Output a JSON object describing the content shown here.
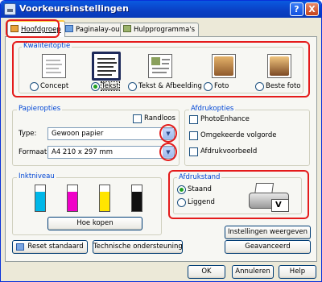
{
  "window": {
    "title": "Voorkeursinstellingen",
    "help_label": "?",
    "close_label": "X"
  },
  "tabs": [
    {
      "label": "Hoofdgroep"
    },
    {
      "label": "Paginalay-out"
    },
    {
      "label": "Hulpprogramma's"
    }
  ],
  "quality": {
    "group_label": "Kwaliteitoptie",
    "options": [
      {
        "label": "Concept",
        "selected": false
      },
      {
        "label": "Tekst",
        "selected": true
      },
      {
        "label": "Tekst & Afbeelding",
        "selected": false
      },
      {
        "label": "Foto",
        "selected": false
      },
      {
        "label": "Beste foto",
        "selected": false
      }
    ]
  },
  "paper": {
    "group_label": "Papieropties",
    "borderless_label": "Randloos",
    "type_label": "Type:",
    "type_value": "Gewoon papier",
    "format_label": "Formaat:",
    "format_value": "A4 210 x 297 mm"
  },
  "print_options": {
    "group_label": "Afdrukopties",
    "items": [
      {
        "label": "PhotoEnhance",
        "checked": false
      },
      {
        "label": "Omgekeerde volgorde",
        "checked": false
      },
      {
        "label": "Afdrukvoorbeeld",
        "checked": false
      }
    ]
  },
  "ink": {
    "group_label": "Inktniveau",
    "levels": [
      {
        "color": "#00b7e8",
        "level": 0.75
      },
      {
        "color": "#f000c8",
        "level": 0.75
      },
      {
        "color": "#ffe500",
        "level": 0.75
      },
      {
        "color": "#111111",
        "level": 0.75
      }
    ],
    "buy_button": "Hoe kopen"
  },
  "orientation": {
    "group_label": "Afdrukstand",
    "portrait_label": "Staand",
    "landscape_label": "Liggend",
    "selected": "portrait"
  },
  "buttons": {
    "show_settings": "Instellingen weergeven",
    "advanced": "Geavanceerd",
    "reset": "Reset standaard",
    "support": "Technische ondersteuning",
    "ok": "OK",
    "cancel": "Annuleren",
    "help": "Help"
  }
}
